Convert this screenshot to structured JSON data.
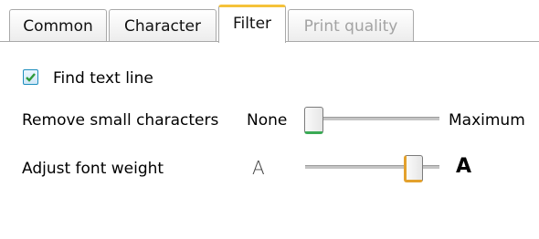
{
  "tabs": [
    {
      "label": "Common",
      "state": "normal"
    },
    {
      "label": "Character",
      "state": "normal"
    },
    {
      "label": "Filter",
      "state": "active"
    },
    {
      "label": "Print quality",
      "state": "disabled"
    }
  ],
  "filter": {
    "find_text_line": {
      "label": "Find text line",
      "checked": true
    },
    "remove_small": {
      "label": "Remove small characters",
      "min_label": "None",
      "max_label": "Maximum",
      "value_fraction": 0.0
    },
    "font_weight": {
      "label": "Adjust font weight",
      "min_icon": "A",
      "max_icon": "A",
      "value_fraction": 0.8
    }
  },
  "colors": {
    "active_tab_accent": "#f5c23a",
    "check_color": "#2d9a3a",
    "slider_min_accent": "#3aaa55",
    "slider_max_accent": "#e3a12d"
  }
}
